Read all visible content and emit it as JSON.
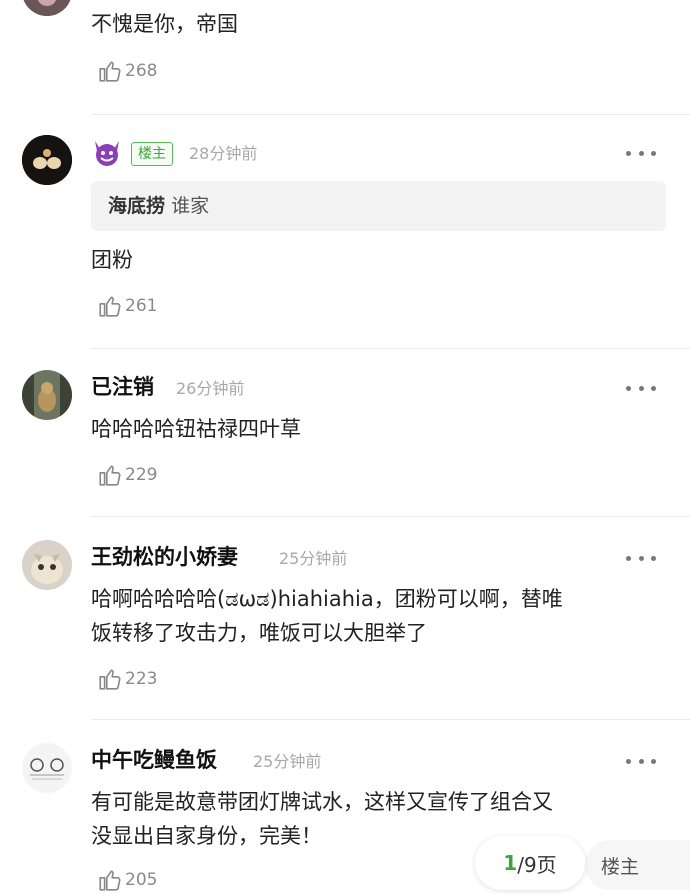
{
  "comments": [
    {
      "username": "",
      "time": "",
      "content": [
        "不愧是你，帝国"
      ],
      "likes": "268"
    },
    {
      "username": "😈",
      "badge": "楼主",
      "time": "28分钟前",
      "quote_name": "海底捞",
      "quote_text": "谁家",
      "content": [
        "团粉"
      ],
      "likes": "261"
    },
    {
      "username": "已注销",
      "time": "26分钟前",
      "content": [
        "哈哈哈哈钮祜禄四叶草"
      ],
      "likes": "229"
    },
    {
      "username": "王劲松的小娇妻",
      "time": "25分钟前",
      "content": [
        "哈啊哈哈哈哈(ಡωಡ)hiahiahia，团粉可以啊，替唯",
        "饭转移了攻击力，唯饭可以大胆举了"
      ],
      "likes": "223"
    },
    {
      "username": "中午吃鳗鱼饭",
      "time": "25分钟前",
      "content": [
        "有可能是故意带团灯牌试水，这样又宣传了组合又",
        "没显出自家身份，完美！"
      ],
      "likes": "205"
    }
  ],
  "pager": {
    "current": "1",
    "total": "/9页"
  },
  "floor_label": "楼主",
  "colors": {
    "badge_green": "#3aa63a",
    "text_gray": "#a8a8a8"
  }
}
